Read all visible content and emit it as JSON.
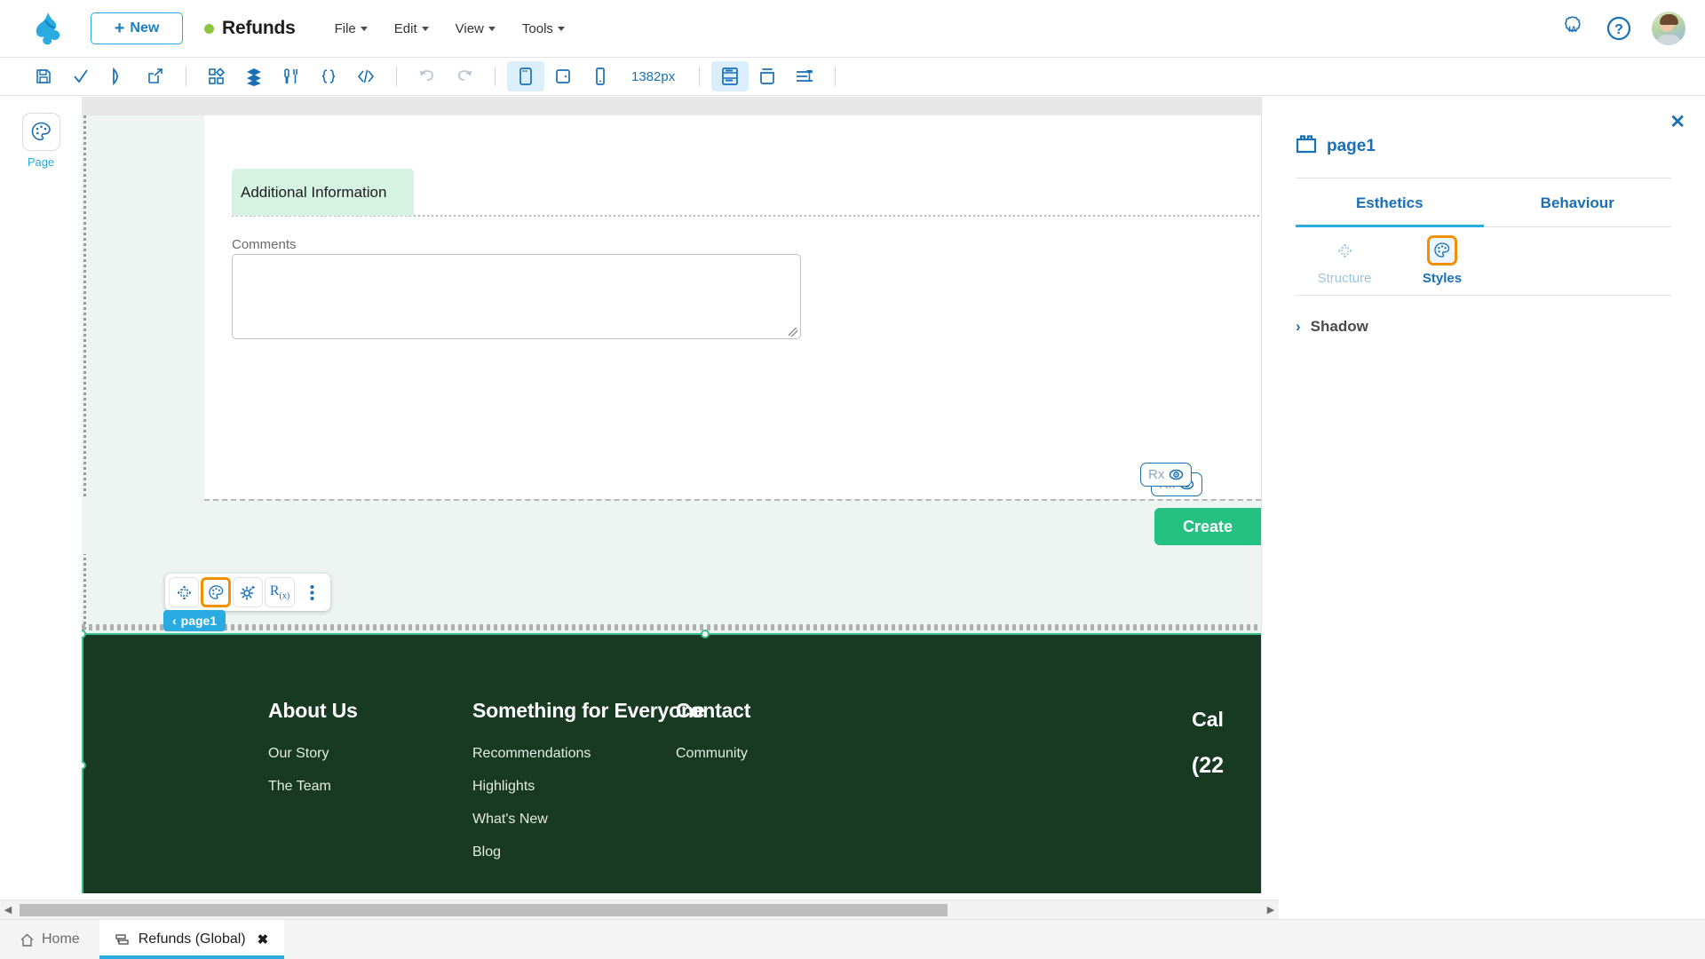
{
  "topbar": {
    "logo_icon": "frog-logo-icon",
    "new_button": {
      "label": "New",
      "plus": "+"
    },
    "project": {
      "name": "Refunds",
      "status_dot_color": "#8cc63f"
    },
    "menus": [
      {
        "label": "File"
      },
      {
        "label": "Edit"
      },
      {
        "label": "View"
      },
      {
        "label": "Tools"
      }
    ],
    "right_icons": [
      {
        "name": "ia-icon",
        "label": "IA"
      },
      {
        "name": "help-icon",
        "label": "?"
      },
      {
        "name": "avatar",
        "label": ""
      }
    ]
  },
  "toolbar": {
    "zoom_value": "1382px",
    "buttons": [
      {
        "name": "save-icon"
      },
      {
        "name": "check-icon"
      },
      {
        "name": "run-icon"
      },
      {
        "name": "publish-icon"
      },
      {
        "name": "components-icon"
      },
      {
        "name": "layers-icon"
      },
      {
        "name": "tools-icon"
      },
      {
        "name": "braces-icon"
      },
      {
        "name": "code-icon"
      },
      {
        "name": "undo-icon"
      },
      {
        "name": "redo-icon"
      },
      {
        "name": "desktop-view-icon"
      },
      {
        "name": "tablet-view-icon"
      },
      {
        "name": "mobile-view-icon"
      },
      {
        "name": "grid-view-icon"
      },
      {
        "name": "container-icon"
      },
      {
        "name": "align-icon"
      }
    ]
  },
  "left_rail": {
    "items": [
      {
        "label": "Page",
        "icon": "palette-icon"
      }
    ]
  },
  "canvas": {
    "section_chip": "Additional Information",
    "field_label": "Comments",
    "comments_value": "",
    "create_button": "Create",
    "rx_badges": [
      {
        "label": "Rx",
        "icon": "eye-icon"
      },
      {
        "label": "Rx",
        "icon": "eye-icon"
      }
    ],
    "float_toolbar": [
      {
        "name": "move-icon"
      },
      {
        "name": "palette-icon"
      },
      {
        "name": "settings-sparkle-icon"
      },
      {
        "name": "rx-function-icon"
      },
      {
        "name": "more-vertical-icon"
      }
    ],
    "page_tag": {
      "chevron": "‹",
      "label": "page1"
    },
    "footer": {
      "columns": [
        {
          "heading": "About Us",
          "links": [
            "Our Story",
            "The Team"
          ]
        },
        {
          "heading": "Something for Everyone",
          "links": [
            "Recommendations",
            "Highlights",
            "What's New",
            "Blog"
          ]
        },
        {
          "heading": "Contact",
          "links": [
            "Community"
          ]
        }
      ],
      "phone_heading": "Cal",
      "phone_number": "(22",
      "background_color": "#183a22"
    }
  },
  "right_panel": {
    "close": "✕",
    "icon": "page-block-icon",
    "title": "page1",
    "tabs": [
      {
        "label": "Esthetics",
        "active": true
      },
      {
        "label": "Behaviour",
        "active": false
      }
    ],
    "subtabs": [
      {
        "label": "Structure",
        "icon": "move-icon",
        "active": false
      },
      {
        "label": "Styles",
        "icon": "palette-icon",
        "active": true
      }
    ],
    "accordions": [
      {
        "label": "Shadow",
        "chevron": "›"
      }
    ]
  },
  "bottom": {
    "home_label": "Home",
    "tabs": [
      {
        "label": "Refunds (Global)",
        "icon": "module-icon",
        "close": "✖",
        "active": true
      }
    ],
    "scroll_left": "◀",
    "scroll_right": "▶"
  }
}
